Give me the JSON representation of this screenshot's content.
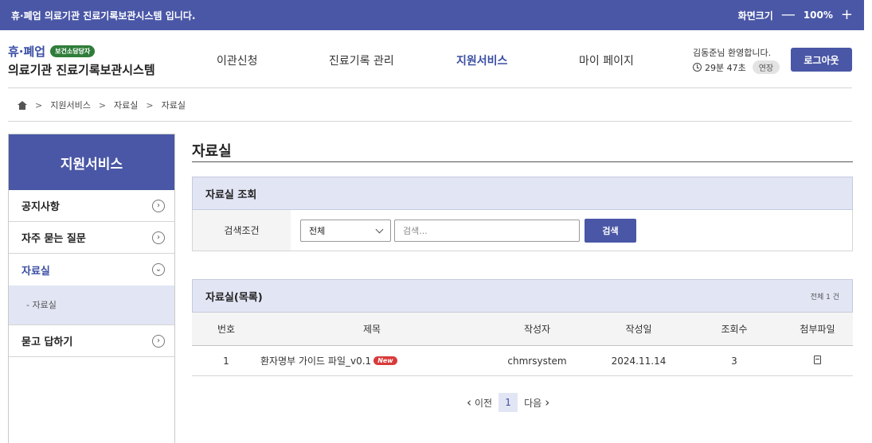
{
  "topbar": {
    "system_notice": "휴·폐업 의료기관 진료기록보관시스템 입니다.",
    "zoom_label": "화면크기",
    "zoom_minus": "—",
    "zoom_value": "100%",
    "zoom_plus": "+"
  },
  "header": {
    "brand": "휴·폐업",
    "badge": "보건소담당자",
    "system_name": "의료기관 진료기록보관시스템",
    "nav": [
      "이관신청",
      "진료기록 관리",
      "지원서비스",
      "마이 페이지"
    ],
    "active_nav": "지원서비스",
    "welcome": "김동준님 환영합니다.",
    "session_time": "29분 47초",
    "extend_label": "연장",
    "logout_label": "로그아웃"
  },
  "breadcrumb": [
    "지원서비스",
    "자료실",
    "자료실"
  ],
  "sidebar": {
    "title": "지원서비스",
    "items": [
      {
        "label": "공지사항",
        "toggle": "›"
      },
      {
        "label": "자주 묻는 질문",
        "toggle": "›"
      },
      {
        "label": "자료실",
        "toggle": "⌄"
      },
      {
        "label": "묻고 답하기",
        "toggle": "›"
      }
    ],
    "sub_item": "- 자료실"
  },
  "page": {
    "title": "자료실",
    "search_panel_title": "자료실 조회",
    "search_label": "검색조건",
    "select_value": "전체",
    "search_placeholder": "검색...",
    "search_button": "검색",
    "list_panel_title": "자료실(목록)",
    "total_count": "전체 1 건"
  },
  "table": {
    "headers": [
      "번호",
      "제목",
      "작성자",
      "작성일",
      "조회수",
      "첨부파일"
    ],
    "rows": [
      {
        "no": "1",
        "title": "환자명부 가이드 파일_v0.1",
        "badge": "New",
        "author": "chmrsystem",
        "date": "2024.11.14",
        "views": "3"
      }
    ]
  },
  "pagination": {
    "prev": "이전",
    "current": "1",
    "next": "다음"
  },
  "colors": {
    "primary": "#4a57a6",
    "light": "#e2e5f4",
    "badge_green": "#2f7d3a",
    "badge_red": "#d93b3b"
  }
}
